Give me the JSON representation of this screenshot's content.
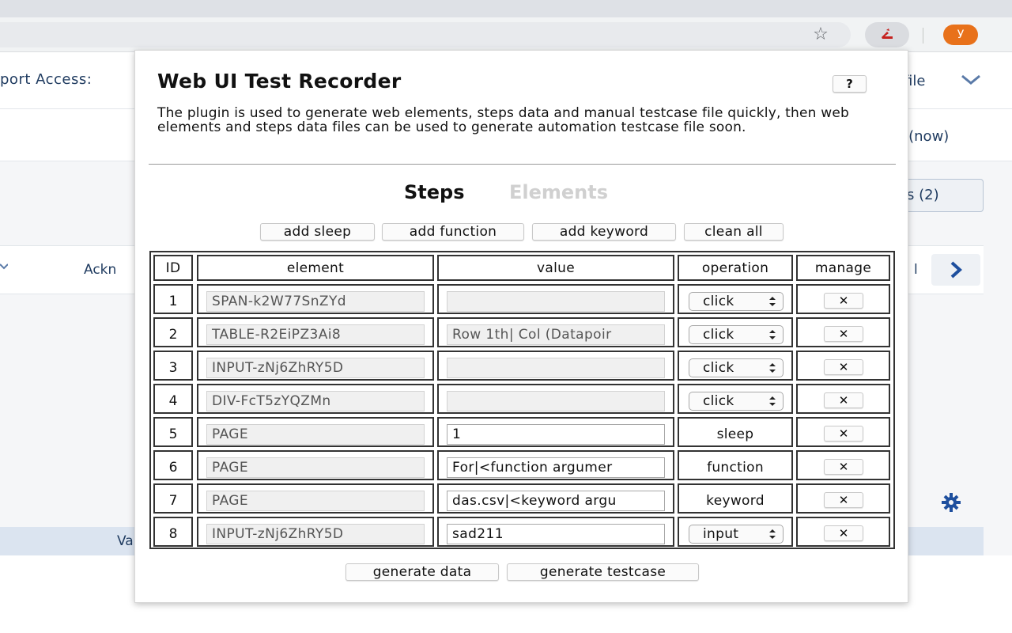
{
  "browser": {
    "avatar_letter": "У",
    "star_icon": "☆",
    "menu_icon": "⋮"
  },
  "background": {
    "support_label": "port Access:",
    "profile_label": "ofile",
    "now_label": "n (now)",
    "count_button": "s (2)",
    "ackn_label": "Ackn",
    "col_label": "l",
    "va_label": "Va"
  },
  "popup": {
    "title": "Web UI Test Recorder",
    "help_label": "?",
    "description": "The plugin is used to generate web elements, steps data and manual testcase file quickly, then web elements and steps data files can be used to generate automation testcase file soon.",
    "tabs": {
      "steps": "Steps",
      "elements": "Elements",
      "active": "Steps"
    },
    "actions": {
      "add_sleep": "add sleep",
      "add_function": "add function",
      "add_keyword": "add keyword",
      "clean_all": "clean all"
    },
    "table": {
      "headers": {
        "id": "ID",
        "element": "element",
        "value": "value",
        "operation": "operation",
        "manage": "manage"
      },
      "delete_label": "✕",
      "rows": [
        {
          "id": "1",
          "element": "SPAN-k2W77SnZYd",
          "value": "",
          "value_editable": false,
          "operation": "click",
          "op_select": true
        },
        {
          "id": "2",
          "element": "TABLE-R2EiPZ3Ai8",
          "value": "Row 1th| Col (Datapoir",
          "value_editable": false,
          "operation": "click",
          "op_select": true
        },
        {
          "id": "3",
          "element": "INPUT-zNj6ZhRY5D",
          "value": "",
          "value_editable": false,
          "operation": "click",
          "op_select": true
        },
        {
          "id": "4",
          "element": "DIV-FcT5zYQZMn",
          "value": "",
          "value_editable": false,
          "operation": "click",
          "op_select": true
        },
        {
          "id": "5",
          "element": "PAGE",
          "value": "1",
          "value_editable": true,
          "operation": "sleep",
          "op_select": false
        },
        {
          "id": "6",
          "element": "PAGE",
          "value": "For|<function argumer",
          "value_editable": true,
          "operation": "function",
          "op_select": false
        },
        {
          "id": "7",
          "element": "PAGE",
          "value": "das.csv|<keyword argu",
          "value_editable": true,
          "operation": "keyword",
          "op_select": false
        },
        {
          "id": "8",
          "element": "INPUT-zNj6ZhRY5D",
          "value": "sad211",
          "value_editable": true,
          "operation": "input",
          "op_select": true
        }
      ]
    },
    "footer": {
      "generate_data": "generate data",
      "generate_testcase": "generate testcase"
    }
  }
}
